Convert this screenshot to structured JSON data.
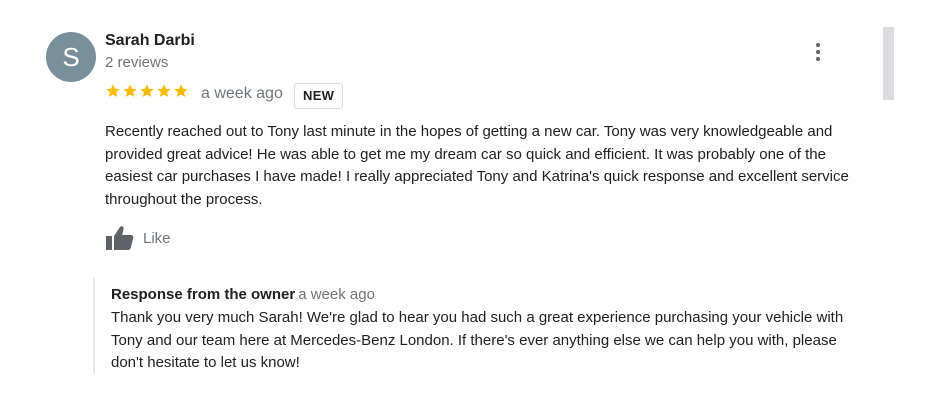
{
  "review": {
    "avatar_initial": "S",
    "reviewer_name": "Sarah Darbi",
    "review_count": "2 reviews",
    "rating": 5,
    "max_rating": 5,
    "date": "a week ago",
    "badge": "NEW",
    "text": "Recently reached out to Tony last minute in the hopes of getting a new car. Tony was very knowledgeable and provided great advice! He was able to get me my dream car so quick and efficient. It was probably one of the easiest car purchases I have made! I really appreciated Tony and Katrina's quick response and excellent service throughout the process.",
    "like_label": "Like"
  },
  "owner_response": {
    "title": "Response from the owner",
    "date": "a week ago",
    "text": "Thank you very much Sarah! We're glad to hear you had such a great experience purchasing your vehicle with Tony and our team here at Mercedes-Benz London. If there's ever anything else we can help you with, please don't hesitate to let us know!"
  },
  "icons": {
    "more": "more-vert-icon",
    "star": "star-icon",
    "like": "thumb-up-icon"
  },
  "colors": {
    "star": "#fbbc04",
    "avatar_bg": "#78909c",
    "secondary_text": "#70757a"
  }
}
